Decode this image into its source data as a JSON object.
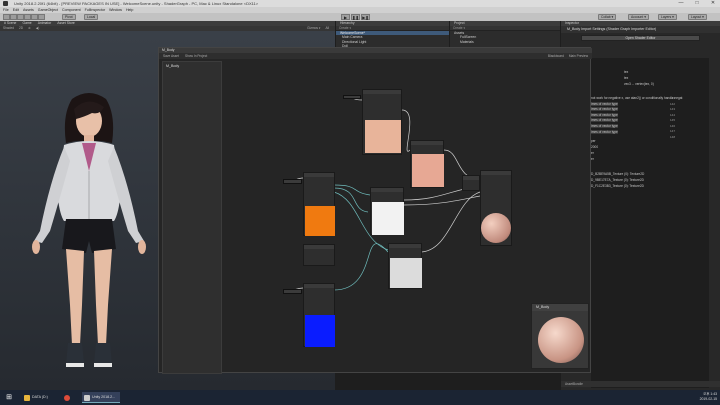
{
  "window": {
    "title": "Unity 2018.2.20f1 (64bit) - [PREVIEW PACKAGES IN USE] - WelcomeScene.unity - ShaderGraph - PC, Mac & Linux Standalone <DX11>",
    "controls": [
      "—",
      "□",
      "✕"
    ]
  },
  "menu": [
    "File",
    "Edit",
    "Assets",
    "GameObject",
    "Component",
    "FullInspector",
    "Window",
    "Help"
  ],
  "toolbar": {
    "pivot": "Pivot",
    "local": "Local",
    "play": "▶",
    "pause": "❚❚",
    "step": "▶❚",
    "collab": "Collab ▾",
    "account": "Account ▾",
    "layers": "Layers ▾",
    "layout": "Layout ▾"
  },
  "scene": {
    "tabs": [
      "# Scene",
      "Game",
      "Animator",
      "Asset Store"
    ],
    "subbar": [
      "Shaded",
      "2D",
      "✲",
      "◀)"
    ],
    "subbar_right": [
      "Gizmos ▾",
      "All"
    ]
  },
  "hierarchy": {
    "tab": "Hierarchy",
    "search": "Create ▾",
    "scene": "WelcomeScene*",
    "items": [
      "Main Camera",
      "Directional Light",
      "Doll"
    ]
  },
  "project": {
    "tab": "Project",
    "search": "Create ▾",
    "root": "Assets",
    "items": [
      "FullScreen",
      "Materials"
    ]
  },
  "inspector": {
    "tab": "Inspector",
    "title": "M_Body Import Settings (Shader Graph Importer Editor)",
    "button": "Open Shader Editor",
    "code_lines": [
      "tex",
      "tex",
      "vec3 ... vertex(tex, 0)",
      "not work for negative x, use atan2() or conditionally handle negat",
      "imes of vector type",
      "imes of vector type",
      "imes of vector type",
      "imes of vector type",
      "imes of vector type",
      "imes of vector type",
      "per",
      "2000",
      "er",
      "er",
      "D_B2BE9A5B_Texture (0): Texture2D",
      "D_9BE17E7A_Texture (0): Texture2D",
      "D_F1C2E3B3_Texture (0): Texture2D"
    ],
    "line_numbers": [
      "141",
      "142",
      "143",
      "144",
      "145",
      "146",
      "147",
      "148"
    ]
  },
  "graph": {
    "tab": "M_Body",
    "bar": [
      "Save Asset",
      "Show In Project"
    ],
    "bar_right": [
      "Blackboard",
      "Main Preview"
    ],
    "blackboard_title": "M_Body",
    "preview_title": "M_Body"
  },
  "console": {
    "label": "AssetBundle"
  },
  "taskbar": {
    "start": "⊞",
    "items": [
      {
        "label": "DATA (D:)",
        "color": "#e6b43c"
      },
      {
        "label": "",
        "color": "#dd4b39"
      },
      {
        "label": "Unity 2018.2...",
        "color": "#cccccc"
      }
    ],
    "clock": "오후 1:43",
    "date": "2019-02-15"
  },
  "colors": {
    "node_skin": "#e8b49a",
    "node_orange": "#f07a10",
    "node_blue": "#0a1cff",
    "node_white": "#f2f2f2",
    "wire": "#6fbcbc"
  }
}
